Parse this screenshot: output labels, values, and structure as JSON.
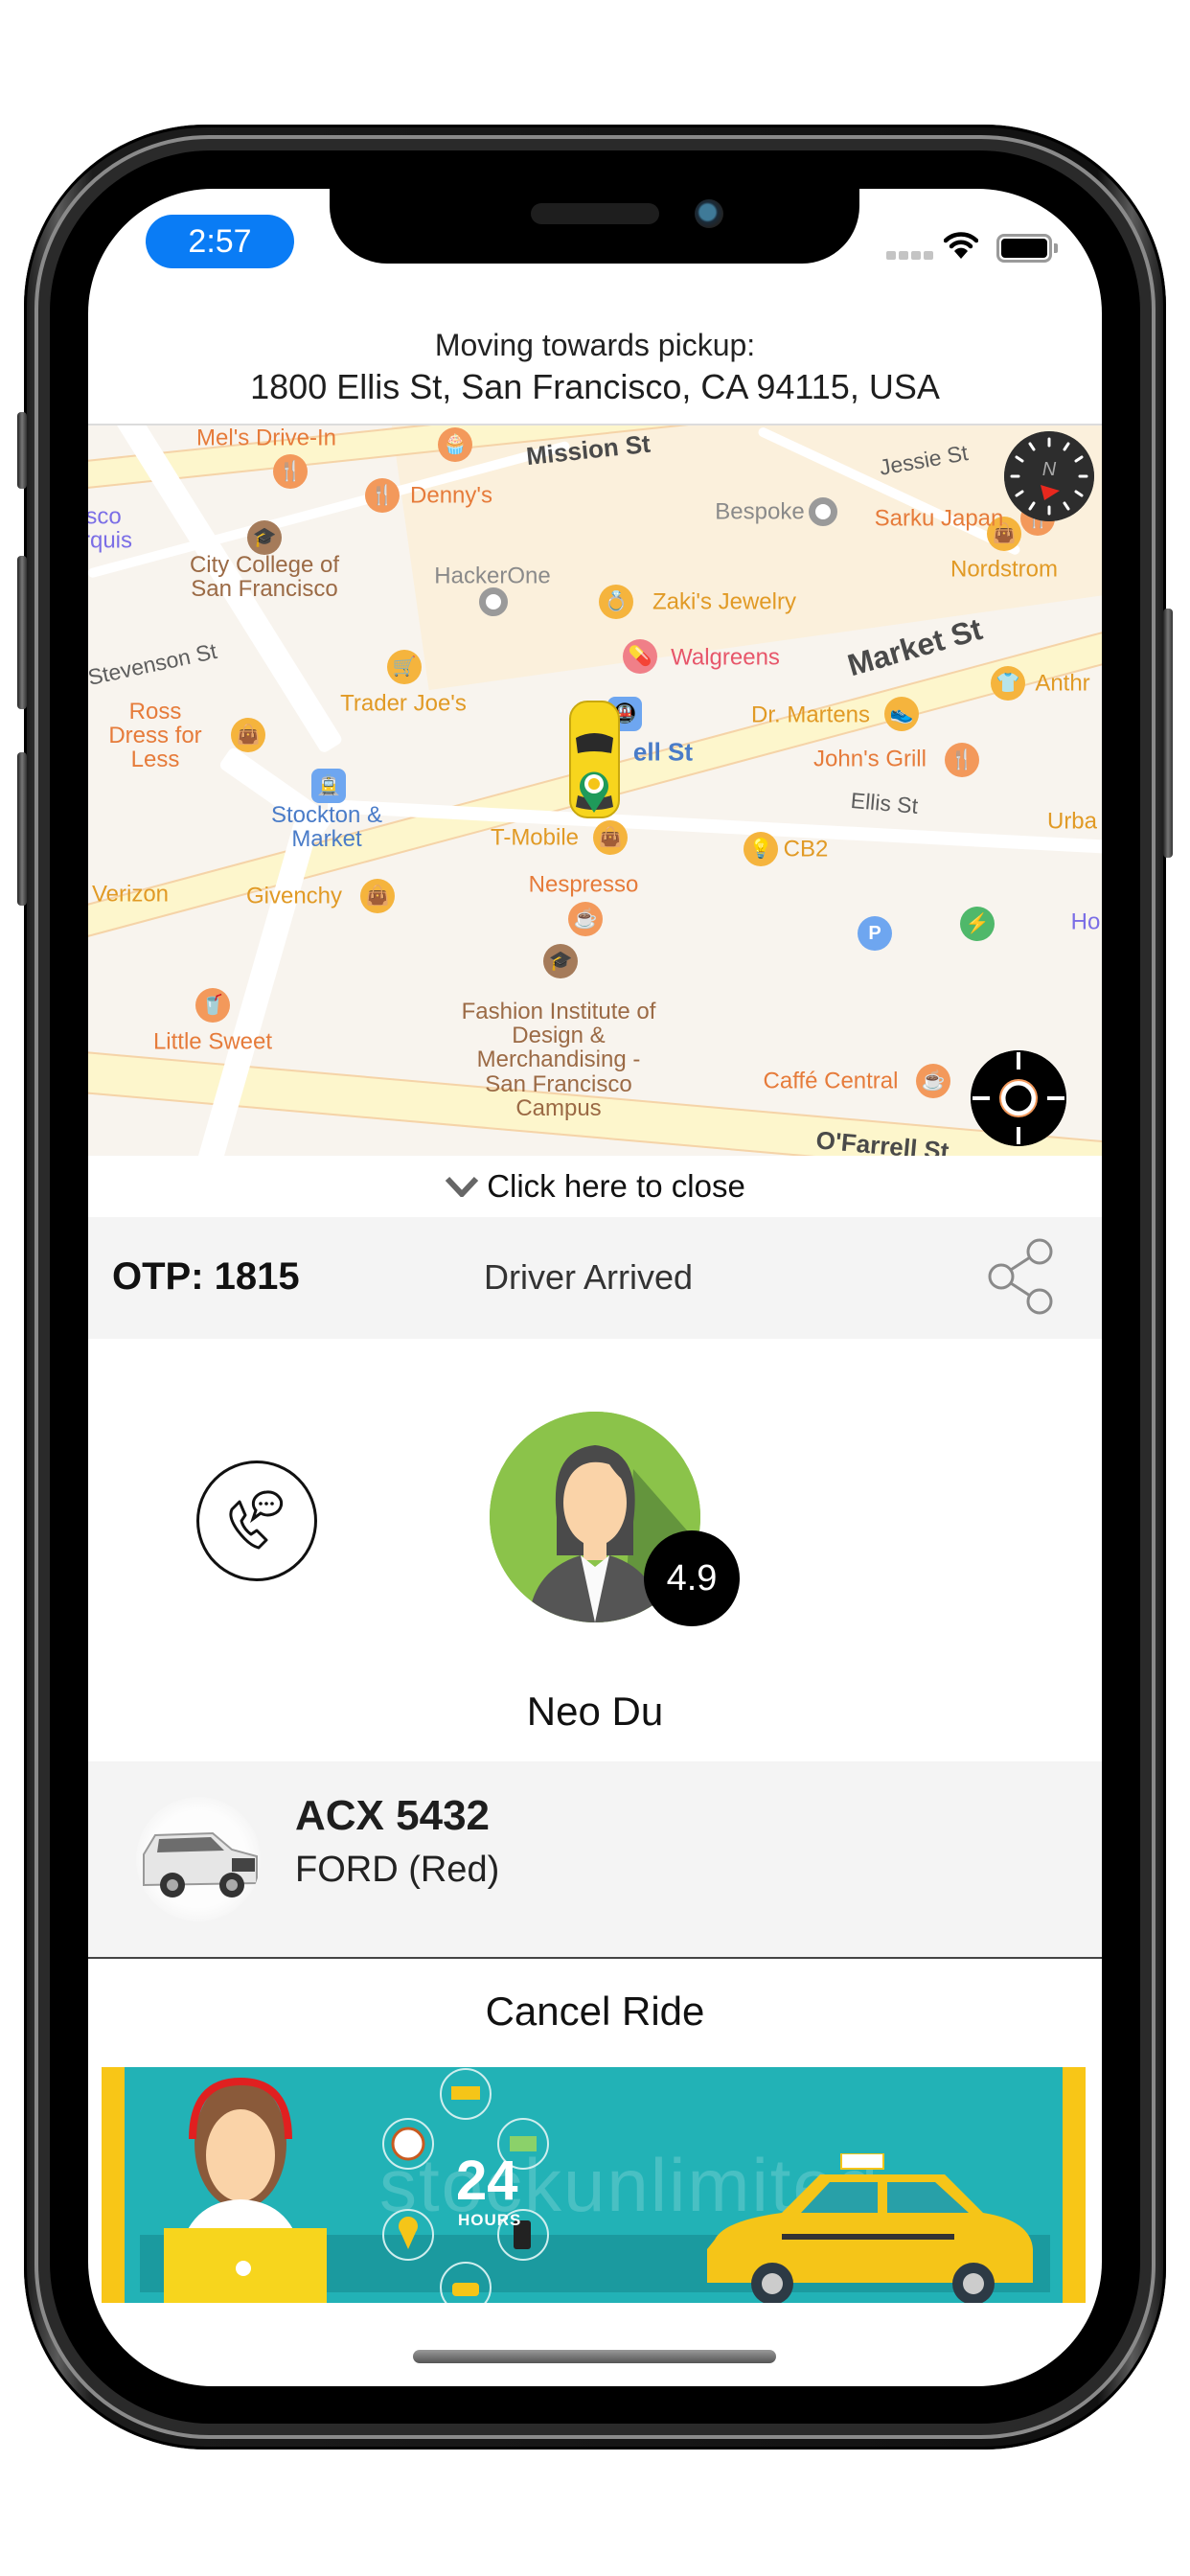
{
  "status_bar": {
    "time": "2:57",
    "signal_icon": "cellular-signal-icon",
    "wifi_icon": "wifi-icon",
    "battery_icon": "battery-icon"
  },
  "header": {
    "title": "Moving towards pickup:",
    "address": "1800 Ellis St, San Francisco, CA 94115, USA"
  },
  "map": {
    "streets": [
      "Mission St",
      "Jessie St",
      "Stevenson St",
      "Market St",
      "Ellis St",
      "O'Farrell St",
      "ell St"
    ],
    "places": [
      "Mel's Drive-In",
      "Denny's",
      "Bespoke",
      "Sarku Japan",
      "Nordstrom",
      "City College of San Francisco",
      "HackerOne",
      "Zaki's Jewelry",
      "Walgreens",
      "Trader Joe's",
      "Anthr",
      "Dr. Martens",
      "Ross Dress for Less",
      "John's Grill",
      "Stockton & Market",
      "Urba",
      "T-Mobile",
      "CB2",
      "Verizon",
      "Givenchy",
      "Nespresso",
      "Ho",
      "Fashion Institute of Design & Merchandising - San Francisco Campus",
      "Little Sweet",
      "Caffé Central",
      "sco",
      "rquis"
    ],
    "compass_icon": "compass-icon",
    "locate_icon": "my-location-icon",
    "vehicle_icon": "taxi-car-icon",
    "pickup_pin_icon": "pickup-pin-icon"
  },
  "panel": {
    "close_label": "Click here to close",
    "otp_label": "OTP: 1815",
    "ride_status": "Driver Arrived",
    "share_icon": "share-icon"
  },
  "driver": {
    "name": "Neo Du",
    "rating": "4.9",
    "call_icon": "call-chat-icon"
  },
  "vehicle": {
    "plate": "ACX 5432",
    "model": "FORD (Red)"
  },
  "actions": {
    "cancel_label": "Cancel Ride"
  },
  "banner": {
    "headline_number": "24",
    "headline_unit": "HOURS",
    "watermark": "stockunlimited"
  },
  "colors": {
    "time_pill": "#0a7cf5",
    "map_bg": "#f8f4ee",
    "panel_gray": "#f4f4f4",
    "avatar_green": "#8bc34a",
    "banner_teal": "#22b2b6",
    "banner_yellow": "#f8c617"
  }
}
